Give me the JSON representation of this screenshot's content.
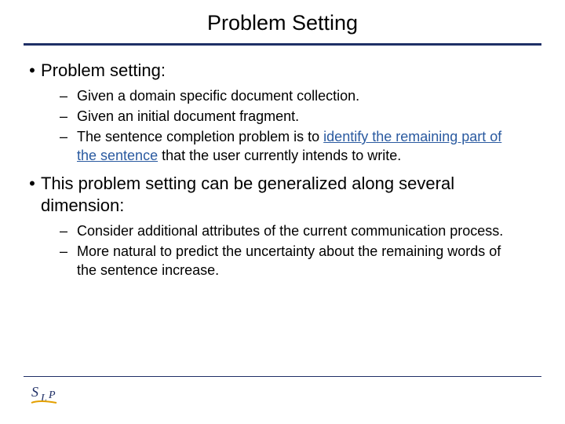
{
  "title": "Problem Setting",
  "bullets": [
    {
      "text": "Problem setting:",
      "subs": [
        {
          "plain": "Given a domain specific document collection."
        },
        {
          "plain": "Given an initial document fragment."
        },
        {
          "prefix": "The sentence completion problem is to ",
          "highlight_underline": "identify the remaining part of the sentence",
          "suffix": " that the user currently intends to write."
        }
      ]
    },
    {
      "text": "This problem setting can be generalized along several dimension:",
      "subs": [
        {
          "plain": "Consider additional attributes of the current communication process."
        },
        {
          "plain": "More natural to predict the uncertainty about the remaining words of the sentence increase."
        }
      ]
    }
  ],
  "logo_text": "SLP"
}
